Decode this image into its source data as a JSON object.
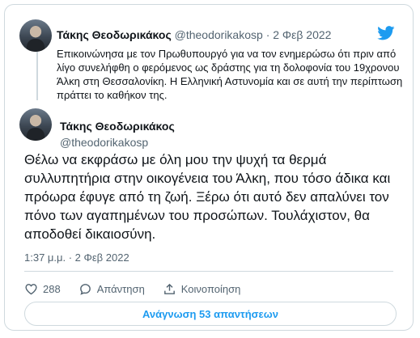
{
  "quoted_tweet": {
    "author_name": "Τάκης Θεοδωρικάκος",
    "author_handle": "@theodorikakosp",
    "separator": "·",
    "date": "2 Φεβ 2022",
    "text": "Επικοινώνησα με τον Πρωθυπουργό  για να τον ενημερώσω ότι πριν από λίγο συνελήφθη ο φερόμενος ως δράστης για τη δολοφονία του 19χρονου Άλκη στη Θεσσαλονίκη. Η Ελληνική Αστυνομία και σε αυτή την περίπτωση πράττει το καθήκον της."
  },
  "main_tweet": {
    "author_name": "Τάκης Θεοδωρικάκος",
    "author_handle": "@theodorikakosp",
    "text": "Θέλω να εκφράσω με όλη μου την ψυχή τα θερμά συλλυπητήρια στην οικογένεια του Άλκη, που τόσο άδικα και πρόωρα έφυγε από τη ζωή. Ξέρω ότι αυτό δεν απαλύνει τον πόνο των αγαπημένων του προσώπων. Τουλάχιστον, θα αποδοθεί δικαιοσύνη.",
    "timestamp": "1:37 μ.μ. · 2 Φεβ 2022"
  },
  "actions": {
    "likes_count": "288",
    "reply_label": "Απάντηση",
    "share_label": "Κοινοποίηση"
  },
  "replies_button": "Ανάγνωση 53 απαντήσεων",
  "colors": {
    "accent": "#1d9bf0",
    "muted": "#536471",
    "border": "#cfd9de"
  },
  "icons": [
    "twitter-bird-icon",
    "heart-icon",
    "reply-icon",
    "share-icon"
  ]
}
